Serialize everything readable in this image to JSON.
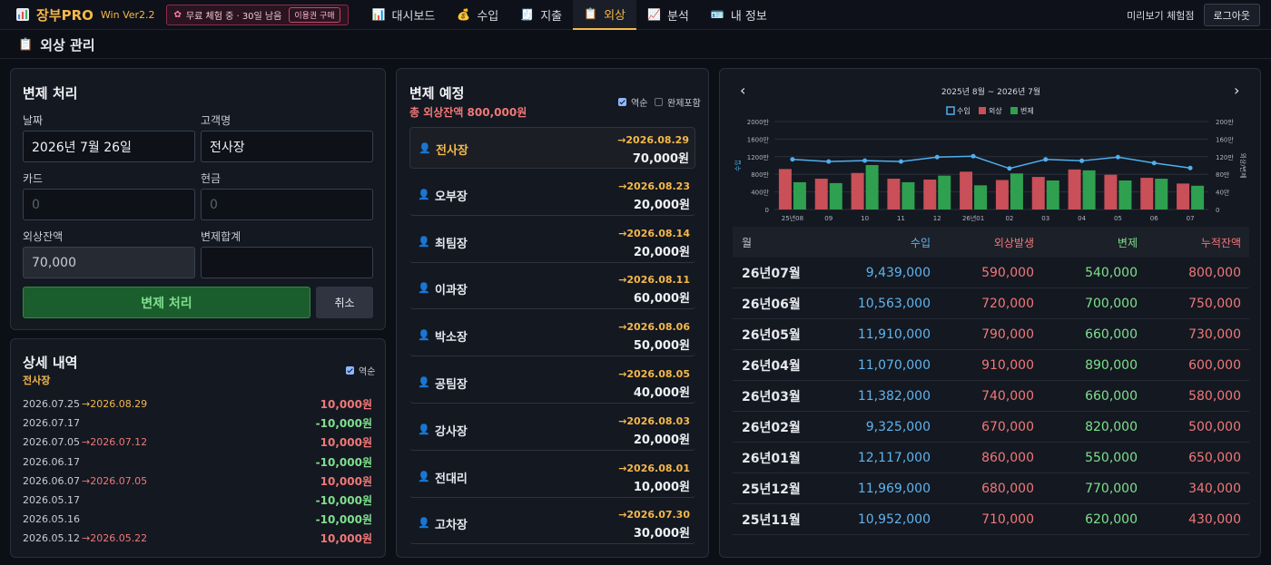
{
  "app": {
    "name": "장부PRO",
    "version": "Win Ver2.2",
    "trial_text": "무료 체험 중 · 30일 남음",
    "buy_label": "이용권 구매",
    "preview_text": "미리보기 체험점",
    "logout_label": "로그아웃",
    "accent": "#f5b84a"
  },
  "nav": [
    {
      "label": "대시보드",
      "icon": "chart-icon"
    },
    {
      "label": "수입",
      "icon": "money-bag-icon"
    },
    {
      "label": "지출",
      "icon": "receipt-icon"
    },
    {
      "label": "외상",
      "icon": "clipboard-icon",
      "active": true
    },
    {
      "label": "분석",
      "icon": "trend-icon"
    },
    {
      "label": "내 정보",
      "icon": "id-card-icon"
    }
  ],
  "page": {
    "title": "외상 관리"
  },
  "repay": {
    "title": "변제 처리",
    "date_label": "날짜",
    "date_value": "2026년 7월 26일",
    "customer_label": "고객명",
    "customer_value": "전사장",
    "card_label": "카드",
    "card_placeholder": "0",
    "cash_label": "현금",
    "cash_placeholder": "0",
    "balance_label": "외상잔액",
    "balance_value": "70,000",
    "total_label": "변제합계",
    "total_value": "",
    "submit_label": "변제 처리",
    "cancel_label": "취소"
  },
  "detail": {
    "title": "상세 내역",
    "customer": "전사장",
    "reverse_label": "역순",
    "items": [
      {
        "date": "2026.07.25",
        "next": "→2026.08.29",
        "next_color": "#f5b84a",
        "amount": "10,000원",
        "amount_color": "#f07878"
      },
      {
        "date": "2026.07.17",
        "next": "",
        "next_color": "",
        "amount": "-10,000원",
        "amount_color": "#7ee08d"
      },
      {
        "date": "2026.07.05",
        "next": "→2026.07.12",
        "next_color": "#f07878",
        "amount": "10,000원",
        "amount_color": "#f07878"
      },
      {
        "date": "2026.06.17",
        "next": "",
        "next_color": "",
        "amount": "-10,000원",
        "amount_color": "#7ee08d"
      },
      {
        "date": "2026.06.07",
        "next": "→2026.07.05",
        "next_color": "#f07878",
        "amount": "10,000원",
        "amount_color": "#f07878"
      },
      {
        "date": "2026.05.17",
        "next": "",
        "next_color": "",
        "amount": "-10,000원",
        "amount_color": "#7ee08d"
      },
      {
        "date": "2026.05.16",
        "next": "",
        "next_color": "",
        "amount": "-10,000원",
        "amount_color": "#7ee08d"
      },
      {
        "date": "2026.05.12",
        "next": "→2026.05.22",
        "next_color": "#f07878",
        "amount": "10,000원",
        "amount_color": "#f07878"
      }
    ]
  },
  "schedule": {
    "title": "변제 예정",
    "total_text": "총 외상잔액 800,000원",
    "reverse_label": "역순",
    "include_done_label": "완제포함",
    "items": [
      {
        "name": "전사장",
        "date": "→2026.08.29",
        "amount": "70,000원",
        "selected": true
      },
      {
        "name": "오부장",
        "date": "→2026.08.23",
        "amount": "20,000원"
      },
      {
        "name": "최팀장",
        "date": "→2026.08.14",
        "amount": "20,000원"
      },
      {
        "name": "이과장",
        "date": "→2026.08.11",
        "amount": "60,000원"
      },
      {
        "name": "박소장",
        "date": "→2026.08.06",
        "amount": "50,000원"
      },
      {
        "name": "공팀장",
        "date": "→2026.08.05",
        "amount": "40,000원"
      },
      {
        "name": "강사장",
        "date": "→2026.08.03",
        "amount": "20,000원"
      },
      {
        "name": "전대리",
        "date": "→2026.08.01",
        "amount": "10,000원"
      },
      {
        "name": "고차장",
        "date": "→2026.07.30",
        "amount": "30,000원"
      }
    ]
  },
  "chart_data": {
    "type": "bar",
    "title": "2025년 8월 ~ 2026년 7월",
    "categories": [
      "25년08",
      "09",
      "10",
      "11",
      "12",
      "26년01",
      "02",
      "03",
      "04",
      "05",
      "06",
      "07"
    ],
    "series": [
      {
        "name": "수입",
        "kind": "line",
        "axis": "left",
        "color": "#4fb0ee",
        "values": [
          11400000,
          10900000,
          11100000,
          10900000,
          11900000,
          12117000,
          9325000,
          11382000,
          11070000,
          11910000,
          10563000,
          9439000
        ]
      },
      {
        "name": "외상",
        "kind": "bar",
        "axis": "right",
        "color": "#c94f58",
        "values": [
          920000,
          700000,
          830000,
          700000,
          680000,
          860000,
          670000,
          740000,
          910000,
          790000,
          720000,
          590000
        ]
      },
      {
        "name": "변제",
        "kind": "bar",
        "axis": "right",
        "color": "#2fa04f",
        "values": [
          620000,
          600000,
          1010000,
          620000,
          770000,
          550000,
          820000,
          660000,
          890000,
          660000,
          700000,
          540000
        ]
      }
    ],
    "ylabel": "수입",
    "ylabel_right": "외상/변제",
    "left_ticks": [
      "0",
      "400만",
      "800만",
      "1200만",
      "1600만",
      "2000만"
    ],
    "right_ticks": [
      "0",
      "40만",
      "80만",
      "120만",
      "160만",
      "200만"
    ],
    "ylim": [
      0,
      20000000
    ],
    "ylim_right": [
      0,
      2000000
    ],
    "legend_position": "top-center",
    "grid": true,
    "prev_label": "‹",
    "next_label": "›"
  },
  "monthly": {
    "headers": [
      "월",
      "수입",
      "외상발생",
      "변제",
      "누적잔액"
    ],
    "rows": [
      [
        "26년07월",
        "9,439,000",
        "590,000",
        "540,000",
        "800,000"
      ],
      [
        "26년06월",
        "10,563,000",
        "720,000",
        "700,000",
        "750,000"
      ],
      [
        "26년05월",
        "11,910,000",
        "790,000",
        "660,000",
        "730,000"
      ],
      [
        "26년04월",
        "11,070,000",
        "910,000",
        "890,000",
        "600,000"
      ],
      [
        "26년03월",
        "11,382,000",
        "740,000",
        "660,000",
        "580,000"
      ],
      [
        "26년02월",
        "9,325,000",
        "670,000",
        "820,000",
        "500,000"
      ],
      [
        "26년01월",
        "12,117,000",
        "860,000",
        "550,000",
        "650,000"
      ],
      [
        "25년12월",
        "11,969,000",
        "680,000",
        "770,000",
        "340,000"
      ],
      [
        "25년11월",
        "10,952,000",
        "710,000",
        "620,000",
        "430,000"
      ]
    ]
  }
}
